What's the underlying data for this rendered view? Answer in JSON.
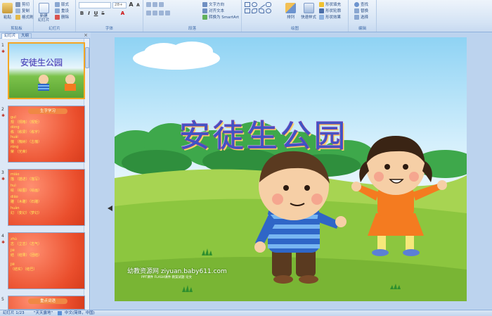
{
  "ribbon": {
    "clipboard": {
      "label": "剪贴板",
      "paste": "粘贴",
      "cut": "剪切",
      "copy": "复制",
      "format_painter": "格式刷"
    },
    "slides": {
      "label": "幻灯片",
      "new_slide": "新建\n幻灯片",
      "layout": "版式",
      "reset": "重设",
      "delete": "删除"
    },
    "font": {
      "label": "字体",
      "size": "28+"
    },
    "paragraph": {
      "label": "段落",
      "text_direction": "文字方向",
      "align_text": "对齐文本",
      "smartart": "转换为 SmartArt"
    },
    "drawing": {
      "label": "绘图",
      "arrange": "排列",
      "quick_styles": "快速样式",
      "fill": "形状填充",
      "outline": "形状轮廓",
      "effects": "形状效果"
    },
    "editing": {
      "label": "编辑",
      "find": "查找",
      "replace": "替换",
      "select": "选择"
    }
  },
  "pane": {
    "tab_slides": "幻灯片",
    "tab_outline": "大纲",
    "close": "×",
    "slides": [
      {
        "num": "1",
        "title": "安徒生公园"
      },
      {
        "num": "2",
        "header": "生字学习",
        "lines": [
          [
            "guī",
            "规 （规格）（规矩）"
          ],
          [
            "dòng",
            "栋 （栋梁）（栋宇）"
          ],
          [
            "huái",
            "槐 （槐树）（古槐）"
          ],
          [
            "róng",
            "荣 （光荣）"
          ]
        ]
      },
      {
        "num": "3",
        "lines": [
          [
            "miáo",
            "描 （描述）（描写）"
          ],
          [
            "huì",
            "绘 （绘图）（绘画）"
          ],
          [
            "diāo",
            "雕 （木雕）（石雕）"
          ],
          [
            "huàn",
            "幻 （变幻）（梦幻）"
          ]
        ]
      },
      {
        "num": "4",
        "lines": [
          [
            "zhù",
            "志 （立志）（志气）"
          ],
          [
            "jié",
            "结 （结果）（团结）"
          ],
          [
            "jiē",
            "（结实）（结巴）"
          ]
        ]
      },
      {
        "num": "5",
        "header": "重点词语"
      }
    ]
  },
  "slide": {
    "title": "安徒生公园",
    "watermark": "幼教资源网 ziyuan.baby611.com",
    "watermark_sub": "PPT课件 FLASH课件 教案试题 论文"
  },
  "status": {
    "slide_info": "幻灯片 1/23",
    "theme": "\"天天露地\"",
    "language": "中文(简体，中国)"
  }
}
